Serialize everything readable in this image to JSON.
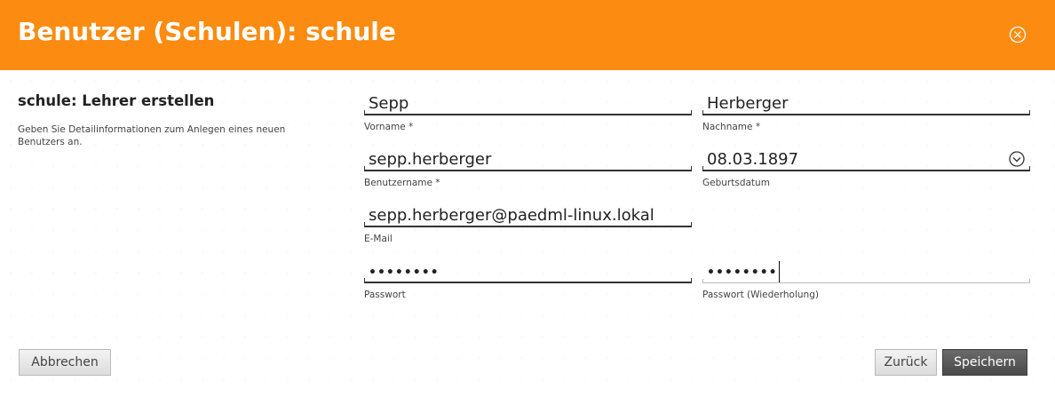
{
  "header": {
    "title": "Benutzer (Schulen): schule",
    "background_color": "#fb8c11",
    "close_icon": "close-circle-icon"
  },
  "side": {
    "title": "schule: Lehrer erstellen",
    "description": "Geben Sie Detailinformationen zum Anlegen eines neuen Benutzers an."
  },
  "form": {
    "vorname": {
      "value": "Sepp",
      "label": "Vorname *"
    },
    "nachname": {
      "value": "Herberger",
      "label": "Nachname *"
    },
    "benutzername": {
      "value": "sepp.herberger",
      "label": "Benutzername *"
    },
    "geburtsdatum": {
      "value": "08.03.1897",
      "label": "Geburtsdatum",
      "icon": "chevron-down-circle-icon"
    },
    "email": {
      "value": "sepp.herberger@paedml-linux.lokal",
      "label": "E-Mail"
    },
    "passwort": {
      "value": "••••••••",
      "label": "Passwort"
    },
    "passwort_wiederholung": {
      "value": "••••••••",
      "label": "Passwort (Wiederholung)"
    }
  },
  "buttons": {
    "cancel": "Abbrechen",
    "back": "Zurück",
    "save": "Speichern"
  }
}
